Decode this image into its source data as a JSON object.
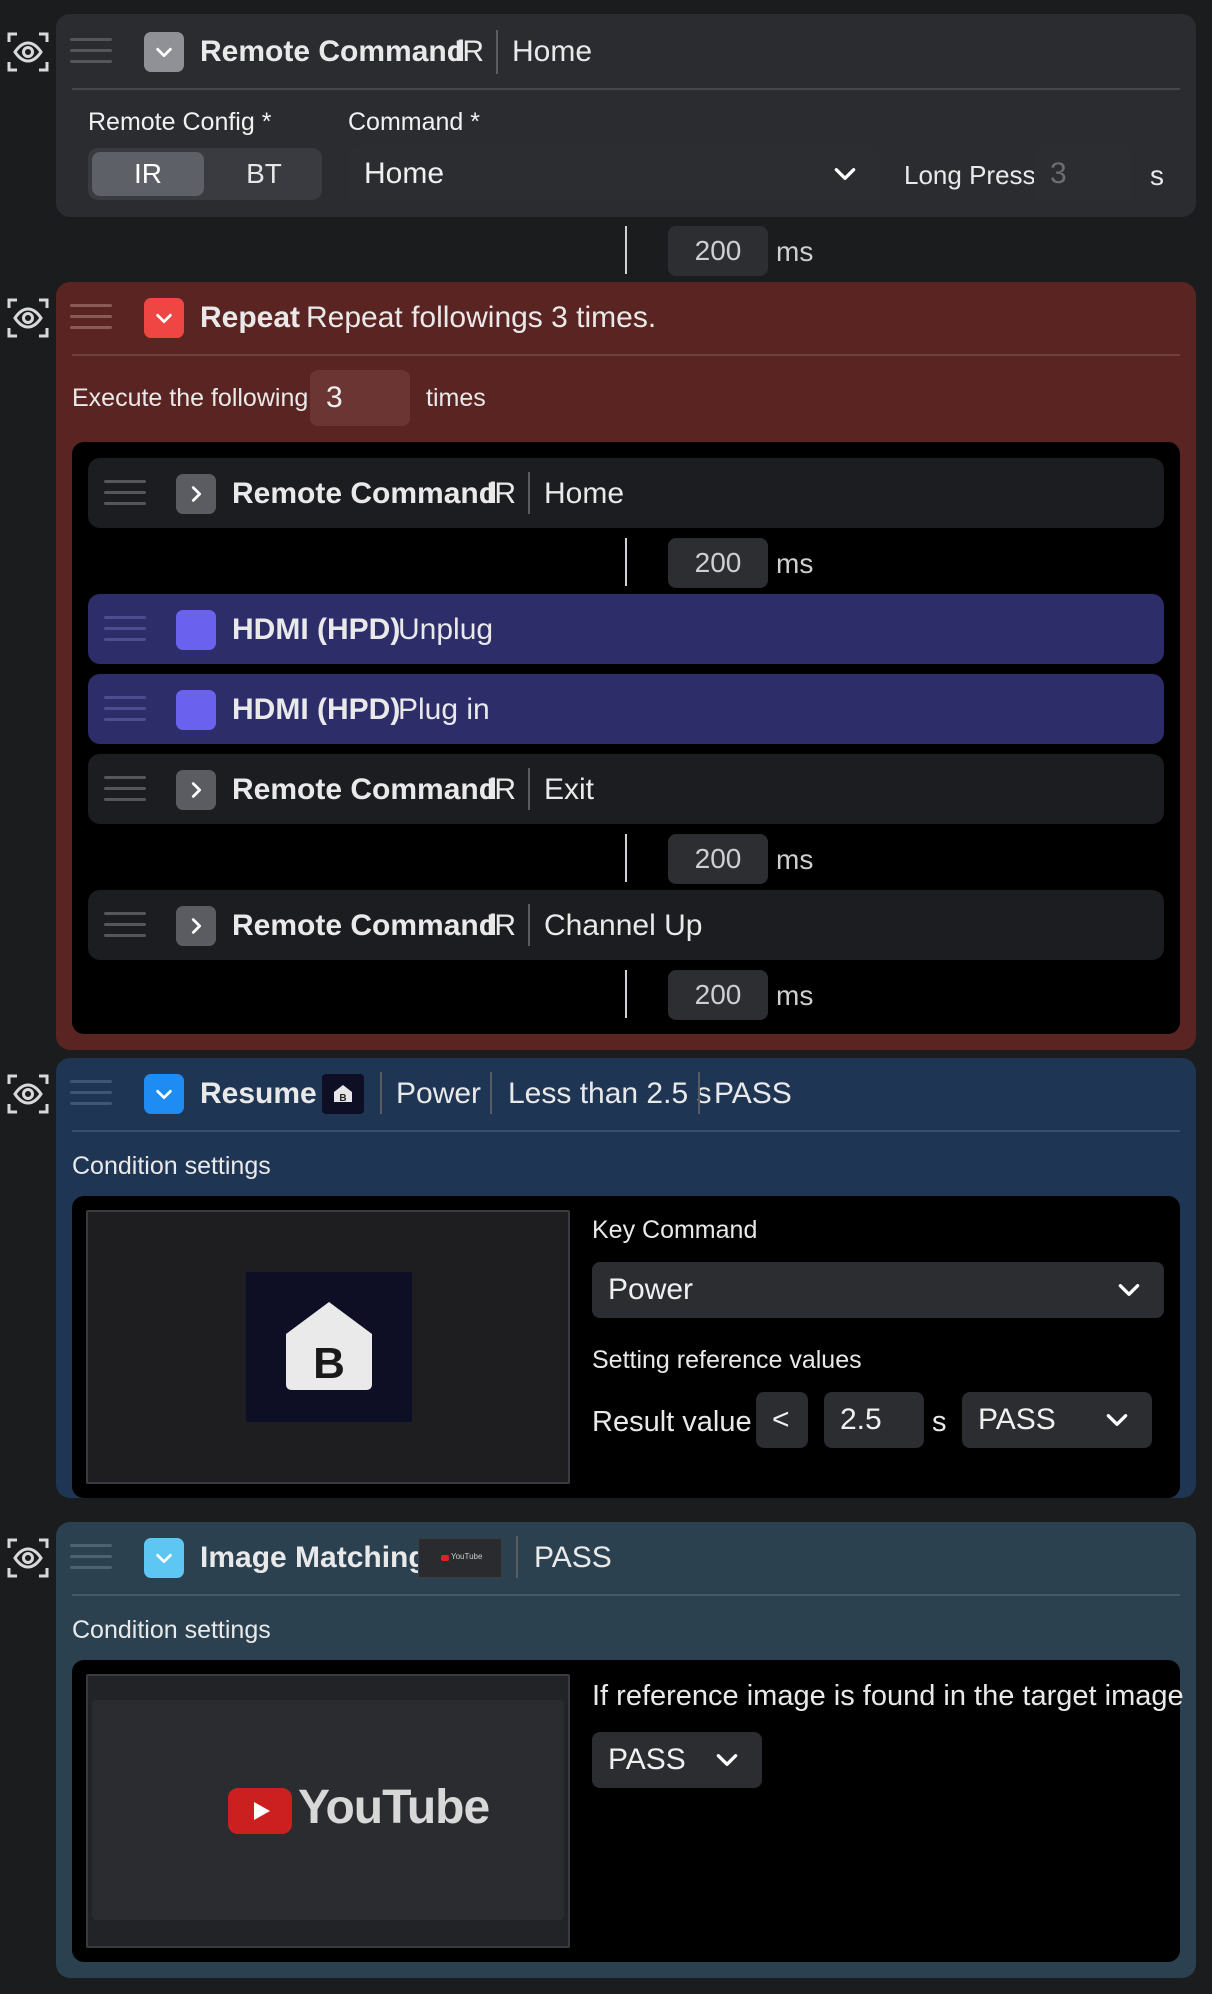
{
  "card_remote": {
    "title": "Remote Command",
    "mode": "IR",
    "command": "Home",
    "remote_config_label": "Remote Config",
    "required_mark": "*",
    "command_label": "Command",
    "seg_ir": "IR",
    "seg_bt": "BT",
    "command_value": "Home",
    "long_press_label": "Long Press",
    "long_press_placeholder": "3",
    "long_press_unit": "s"
  },
  "delay1": {
    "value": "200",
    "unit": "ms"
  },
  "card_repeat": {
    "title": "Repeat",
    "summary": "Repeat followings 3 times.",
    "execute_label": "Execute the following",
    "times_value": "3",
    "times_label": "times",
    "items": [
      {
        "title": "Remote Command",
        "mode": "IR",
        "command": "Home"
      },
      {
        "title": "HDMI (HPD)",
        "action": "Unplug"
      },
      {
        "title": "HDMI (HPD)",
        "action": "Plug in"
      },
      {
        "title": "Remote Command",
        "mode": "IR",
        "command": "Exit"
      },
      {
        "title": "Remote Command",
        "mode": "IR",
        "command": "Channel Up"
      }
    ],
    "delays": [
      {
        "value": "200",
        "unit": "ms"
      },
      {
        "value": "200",
        "unit": "ms"
      },
      {
        "value": "200",
        "unit": "ms"
      }
    ]
  },
  "card_resume": {
    "title": "Resume",
    "key": "Power",
    "condition": "Less than 2.5 s",
    "result": "PASS",
    "condition_settings": "Condition settings",
    "key_command_label": "Key Command",
    "key_command_value": "Power",
    "ref_values_label": "Setting reference values",
    "result_value_label": "Result value",
    "operator": "<",
    "threshold": "2.5",
    "unit": "s",
    "pass_value": "PASS"
  },
  "card_image": {
    "title": "Image Matching",
    "result": "PASS",
    "condition_settings": "Condition settings",
    "found_label": "If reference image is found in the target image",
    "pass_value": "PASS",
    "thumb_text": "YouTube",
    "mini_text": "YouTube"
  },
  "colors": {
    "accent_red": "#ef4643",
    "accent_blue": "#1f8cf3",
    "accent_lightblue": "#5ec6f2",
    "hdmi_purple": "#6a61ee"
  }
}
